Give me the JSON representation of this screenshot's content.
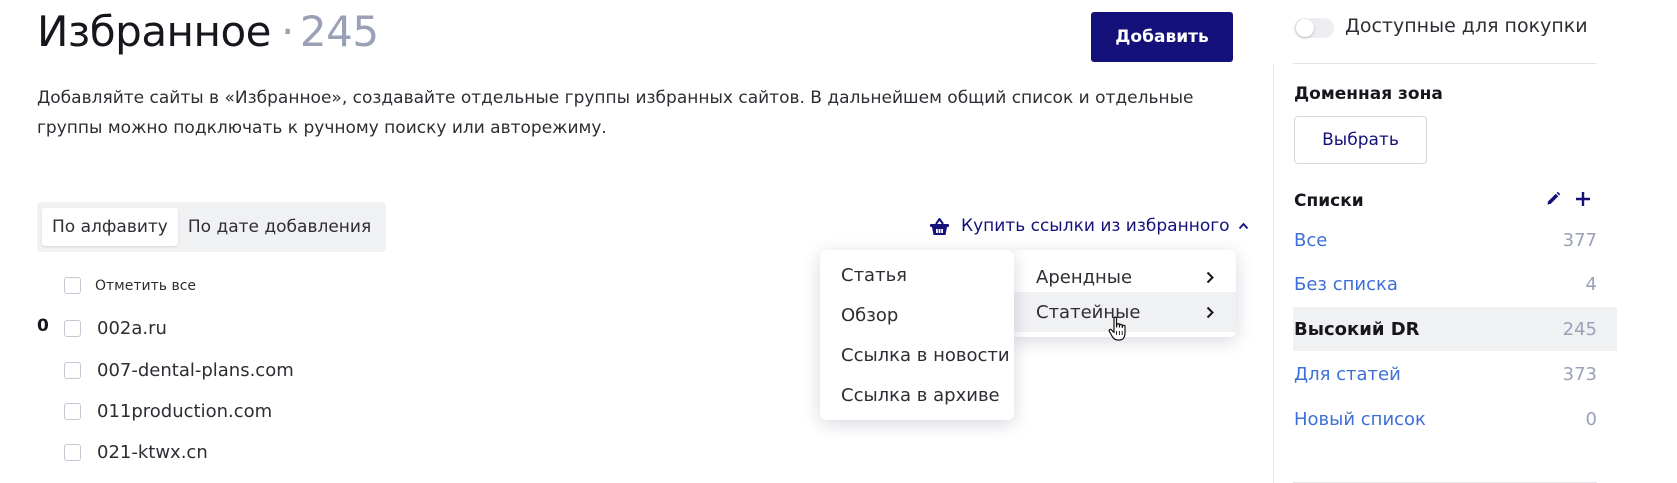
{
  "header": {
    "title": "Избранное",
    "separator": "·",
    "count": "245",
    "add_button": "Добавить",
    "description": "Добавляйте сайты в «Избранное», создавайте отдельные группы избранных сайтов. В дальнейшем общий список и отдельные группы можно подключать к ручному поиску или авторежиму."
  },
  "sort": {
    "options": [
      "По алфавиту",
      "По дате добавления"
    ],
    "active": "По алфавиту"
  },
  "buy_links": {
    "label": "Купить ссылки из избранного",
    "icon": "basket-icon",
    "expanded": true
  },
  "select_all": {
    "label": "Отметить все",
    "checked": false
  },
  "group": {
    "number": "0"
  },
  "domains": [
    "002a.ru",
    "007-dental-plans.com",
    "011production.com",
    "021-ktwx.cn"
  ],
  "dropdown": {
    "main_items": [
      {
        "label": "Арендные",
        "hover": false
      },
      {
        "label": "Статейные",
        "hover": true
      }
    ],
    "submenu_items": [
      "Статья",
      "Обзор",
      "Ссылка в новости",
      "Ссылка в архиве"
    ]
  },
  "sidebar": {
    "purchase_toggle": {
      "label": "Доступные для покупки",
      "on": false
    },
    "domain_zone": {
      "heading": "Доменная зона",
      "button": "Выбрать"
    },
    "lists": {
      "heading": "Списки",
      "edit_icon": "pencil-icon",
      "add_icon": "plus-icon",
      "items": [
        {
          "name": "Все",
          "count": "377"
        },
        {
          "name": "Без списка",
          "count": "4"
        },
        {
          "name": "Высокий DR",
          "count": "245"
        },
        {
          "name": "Для статей",
          "count": "373"
        },
        {
          "name": "Новый список",
          "count": "0"
        }
      ],
      "active": "Высокий DR"
    }
  },
  "colors": {
    "brand": "#14117a",
    "link": "#3d6fd6",
    "muted": "#9aa1b7",
    "hover_bg": "#f0f1f3"
  }
}
